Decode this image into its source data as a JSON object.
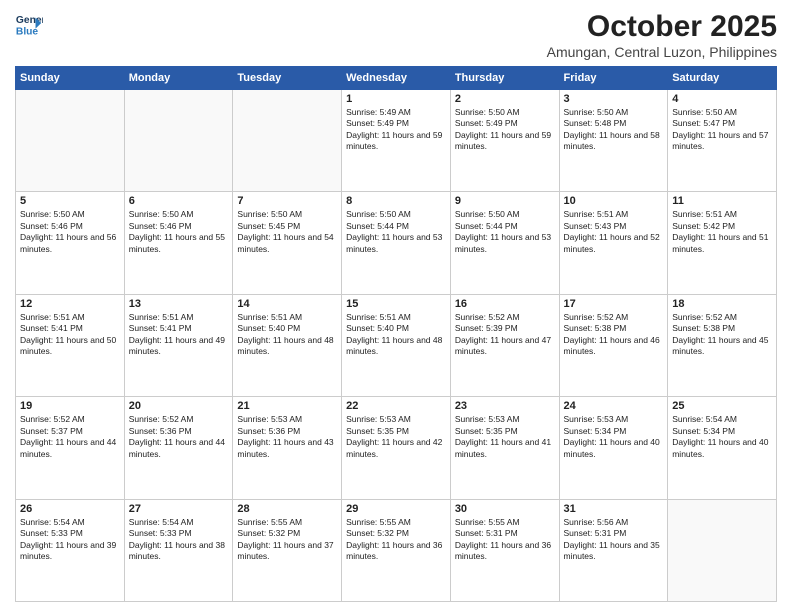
{
  "logo": {
    "line1": "General",
    "line2": "Blue"
  },
  "title": "October 2025",
  "subtitle": "Amungan, Central Luzon, Philippines",
  "weekdays": [
    "Sunday",
    "Monday",
    "Tuesday",
    "Wednesday",
    "Thursday",
    "Friday",
    "Saturday"
  ],
  "weeks": [
    [
      {
        "day": "",
        "empty": true
      },
      {
        "day": "",
        "empty": true
      },
      {
        "day": "",
        "empty": true
      },
      {
        "day": "1",
        "sunrise": "Sunrise: 5:49 AM",
        "sunset": "Sunset: 5:49 PM",
        "daylight": "Daylight: 11 hours and 59 minutes."
      },
      {
        "day": "2",
        "sunrise": "Sunrise: 5:50 AM",
        "sunset": "Sunset: 5:49 PM",
        "daylight": "Daylight: 11 hours and 59 minutes."
      },
      {
        "day": "3",
        "sunrise": "Sunrise: 5:50 AM",
        "sunset": "Sunset: 5:48 PM",
        "daylight": "Daylight: 11 hours and 58 minutes."
      },
      {
        "day": "4",
        "sunrise": "Sunrise: 5:50 AM",
        "sunset": "Sunset: 5:47 PM",
        "daylight": "Daylight: 11 hours and 57 minutes."
      }
    ],
    [
      {
        "day": "5",
        "sunrise": "Sunrise: 5:50 AM",
        "sunset": "Sunset: 5:46 PM",
        "daylight": "Daylight: 11 hours and 56 minutes."
      },
      {
        "day": "6",
        "sunrise": "Sunrise: 5:50 AM",
        "sunset": "Sunset: 5:46 PM",
        "daylight": "Daylight: 11 hours and 55 minutes."
      },
      {
        "day": "7",
        "sunrise": "Sunrise: 5:50 AM",
        "sunset": "Sunset: 5:45 PM",
        "daylight": "Daylight: 11 hours and 54 minutes."
      },
      {
        "day": "8",
        "sunrise": "Sunrise: 5:50 AM",
        "sunset": "Sunset: 5:44 PM",
        "daylight": "Daylight: 11 hours and 53 minutes."
      },
      {
        "day": "9",
        "sunrise": "Sunrise: 5:50 AM",
        "sunset": "Sunset: 5:44 PM",
        "daylight": "Daylight: 11 hours and 53 minutes."
      },
      {
        "day": "10",
        "sunrise": "Sunrise: 5:51 AM",
        "sunset": "Sunset: 5:43 PM",
        "daylight": "Daylight: 11 hours and 52 minutes."
      },
      {
        "day": "11",
        "sunrise": "Sunrise: 5:51 AM",
        "sunset": "Sunset: 5:42 PM",
        "daylight": "Daylight: 11 hours and 51 minutes."
      }
    ],
    [
      {
        "day": "12",
        "sunrise": "Sunrise: 5:51 AM",
        "sunset": "Sunset: 5:41 PM",
        "daylight": "Daylight: 11 hours and 50 minutes."
      },
      {
        "day": "13",
        "sunrise": "Sunrise: 5:51 AM",
        "sunset": "Sunset: 5:41 PM",
        "daylight": "Daylight: 11 hours and 49 minutes."
      },
      {
        "day": "14",
        "sunrise": "Sunrise: 5:51 AM",
        "sunset": "Sunset: 5:40 PM",
        "daylight": "Daylight: 11 hours and 48 minutes."
      },
      {
        "day": "15",
        "sunrise": "Sunrise: 5:51 AM",
        "sunset": "Sunset: 5:40 PM",
        "daylight": "Daylight: 11 hours and 48 minutes."
      },
      {
        "day": "16",
        "sunrise": "Sunrise: 5:52 AM",
        "sunset": "Sunset: 5:39 PM",
        "daylight": "Daylight: 11 hours and 47 minutes."
      },
      {
        "day": "17",
        "sunrise": "Sunrise: 5:52 AM",
        "sunset": "Sunset: 5:38 PM",
        "daylight": "Daylight: 11 hours and 46 minutes."
      },
      {
        "day": "18",
        "sunrise": "Sunrise: 5:52 AM",
        "sunset": "Sunset: 5:38 PM",
        "daylight": "Daylight: 11 hours and 45 minutes."
      }
    ],
    [
      {
        "day": "19",
        "sunrise": "Sunrise: 5:52 AM",
        "sunset": "Sunset: 5:37 PM",
        "daylight": "Daylight: 11 hours and 44 minutes."
      },
      {
        "day": "20",
        "sunrise": "Sunrise: 5:52 AM",
        "sunset": "Sunset: 5:36 PM",
        "daylight": "Daylight: 11 hours and 44 minutes."
      },
      {
        "day": "21",
        "sunrise": "Sunrise: 5:53 AM",
        "sunset": "Sunset: 5:36 PM",
        "daylight": "Daylight: 11 hours and 43 minutes."
      },
      {
        "day": "22",
        "sunrise": "Sunrise: 5:53 AM",
        "sunset": "Sunset: 5:35 PM",
        "daylight": "Daylight: 11 hours and 42 minutes."
      },
      {
        "day": "23",
        "sunrise": "Sunrise: 5:53 AM",
        "sunset": "Sunset: 5:35 PM",
        "daylight": "Daylight: 11 hours and 41 minutes."
      },
      {
        "day": "24",
        "sunrise": "Sunrise: 5:53 AM",
        "sunset": "Sunset: 5:34 PM",
        "daylight": "Daylight: 11 hours and 40 minutes."
      },
      {
        "day": "25",
        "sunrise": "Sunrise: 5:54 AM",
        "sunset": "Sunset: 5:34 PM",
        "daylight": "Daylight: 11 hours and 40 minutes."
      }
    ],
    [
      {
        "day": "26",
        "sunrise": "Sunrise: 5:54 AM",
        "sunset": "Sunset: 5:33 PM",
        "daylight": "Daylight: 11 hours and 39 minutes."
      },
      {
        "day": "27",
        "sunrise": "Sunrise: 5:54 AM",
        "sunset": "Sunset: 5:33 PM",
        "daylight": "Daylight: 11 hours and 38 minutes."
      },
      {
        "day": "28",
        "sunrise": "Sunrise: 5:55 AM",
        "sunset": "Sunset: 5:32 PM",
        "daylight": "Daylight: 11 hours and 37 minutes."
      },
      {
        "day": "29",
        "sunrise": "Sunrise: 5:55 AM",
        "sunset": "Sunset: 5:32 PM",
        "daylight": "Daylight: 11 hours and 36 minutes."
      },
      {
        "day": "30",
        "sunrise": "Sunrise: 5:55 AM",
        "sunset": "Sunset: 5:31 PM",
        "daylight": "Daylight: 11 hours and 36 minutes."
      },
      {
        "day": "31",
        "sunrise": "Sunrise: 5:56 AM",
        "sunset": "Sunset: 5:31 PM",
        "daylight": "Daylight: 11 hours and 35 minutes."
      },
      {
        "day": "",
        "empty": true
      }
    ]
  ]
}
